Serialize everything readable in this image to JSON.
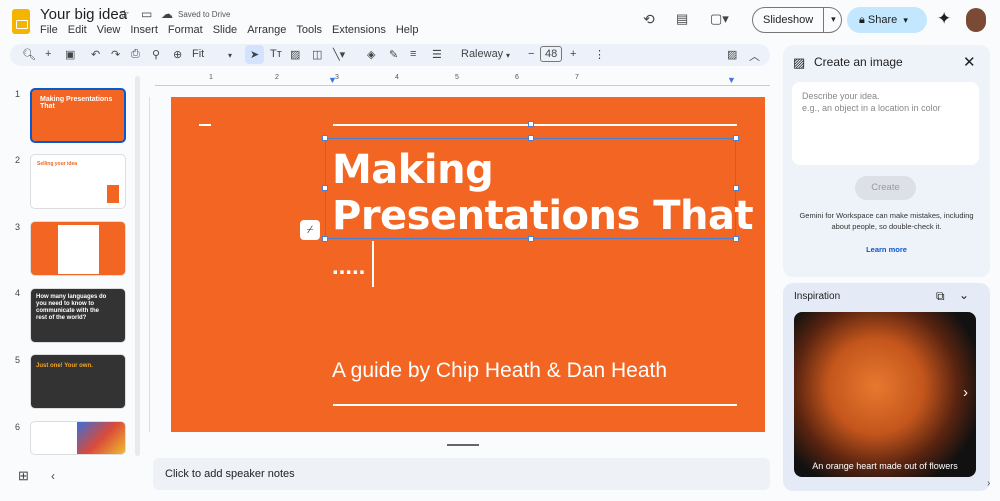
{
  "header": {
    "title": "Your big idea",
    "save_status": "Saved to Drive",
    "menu": [
      "File",
      "Edit",
      "View",
      "Insert",
      "Format",
      "Slide",
      "Arrange",
      "Tools",
      "Extensions",
      "Help"
    ],
    "slideshow": "Slideshow",
    "share": "Share"
  },
  "toolbar": {
    "zoom": "Fit",
    "font": "Raleway",
    "font_size": "48"
  },
  "ruler": [
    "1",
    "2",
    "3",
    "4",
    "5",
    "6",
    "7"
  ],
  "slides": [
    {
      "n": "1",
      "title": "Making Presentations That",
      "bg": "#f26522"
    },
    {
      "n": "2",
      "title": "Selling your idea",
      "bg": "#ffffff"
    },
    {
      "n": "3",
      "title": "",
      "bg": "#f26522"
    },
    {
      "n": "4",
      "title": "How many languages do you need to know to communicate with the rest of the world?",
      "bg": "#333333"
    },
    {
      "n": "5",
      "title": "Just one! Your own.",
      "bg": "#333333"
    },
    {
      "n": "6",
      "title": "",
      "bg": "#ffffff"
    }
  ],
  "slide": {
    "title_line1": "Making",
    "title_line2": "Presentations That",
    "dots": ".....",
    "subtitle": "A guide by Chip Heath & Dan Heath",
    "color": "#f26522"
  },
  "notes": {
    "placeholder": "Click to add speaker notes"
  },
  "panel": {
    "title": "Create an image",
    "placeholder": "Describe your idea.\ne.g., an object in a location in color",
    "create": "Create",
    "disclaimer": "Gemini for Workspace can make mistakes, including about people, so double-check it.",
    "learn_more": "Learn more",
    "inspiration": "Inspiration",
    "caption": "An orange heart made out of flowers"
  }
}
